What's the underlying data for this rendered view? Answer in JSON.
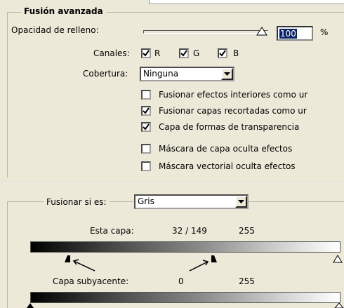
{
  "blend_advanced": {
    "title": "Fusión avanzada",
    "fill_opacity": {
      "label": "Opacidad de relleno:",
      "value": "100",
      "unit": "%",
      "slider_fraction": 1.0
    },
    "channels": {
      "label": "Canales:",
      "items": [
        {
          "label": "R",
          "checked": true
        },
        {
          "label": "G",
          "checked": true
        },
        {
          "label": "B",
          "checked": true
        }
      ]
    },
    "knockout": {
      "label": "Cobertura:",
      "value": "Ninguna"
    },
    "options": [
      {
        "label": "Fusionar efectos interiores como ur",
        "checked": false
      },
      {
        "label": "Fusionar capas recortadas como ur",
        "checked": true
      },
      {
        "label": "Capa de formas de transparencia",
        "checked": true
      },
      {
        "label": "Máscara de capa oculta efectos",
        "checked": false
      },
      {
        "label": "Máscara vectorial oculta efectos",
        "checked": false
      }
    ]
  },
  "blend_if": {
    "label": "Fusionar si es:",
    "value": "Gris",
    "this_layer": {
      "label": "Esta capa:",
      "low": "32 / 149",
      "high": "255"
    },
    "underlying": {
      "label": "Capa subyacente:",
      "low": "0",
      "high": "255"
    }
  }
}
